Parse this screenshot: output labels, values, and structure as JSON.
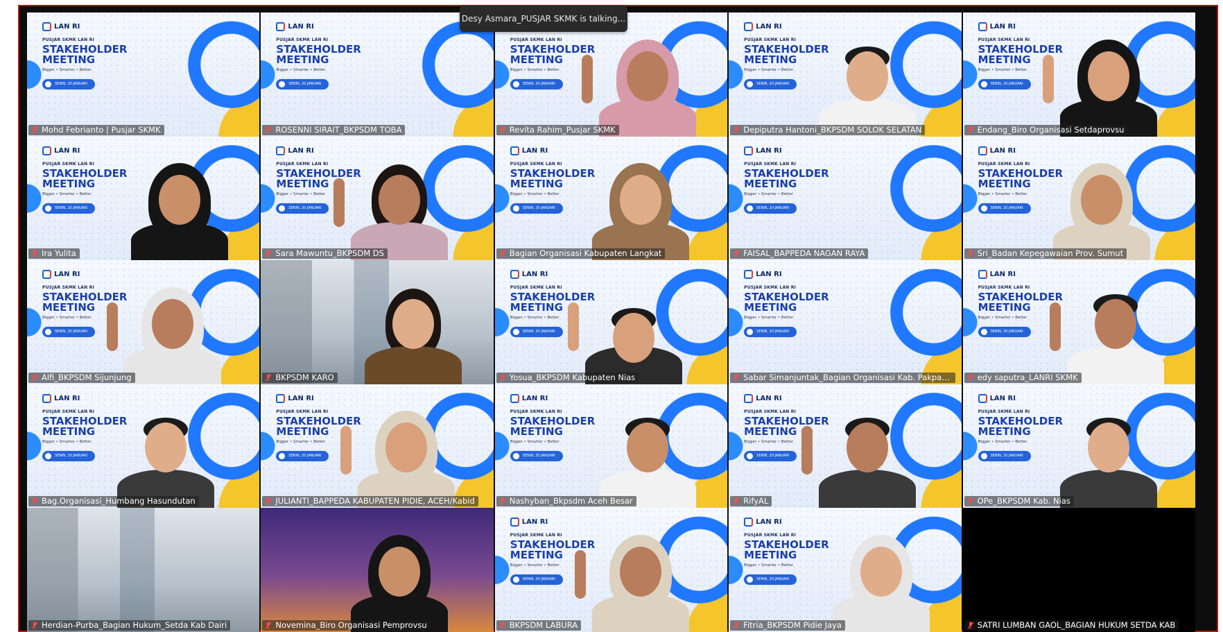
{
  "toast": "Desy Asmara_PUSJAR SKMK is talking...",
  "slide": {
    "logo": "LAN RI",
    "kicker": "PUSJAR SKMK LAN RI",
    "title": "STAKEHOLDER\nMEETING",
    "tagline": "Bigger • Smarter • Better",
    "date": "SENIN, 20 JANUARI 2025"
  },
  "colors": {
    "frame_border": "#b01818",
    "muted_mic": "#ff4a4a",
    "slide_blue": "#1a3fa8",
    "slide_yellow": "#f4c62c"
  },
  "participants": [
    {
      "name": "Mohd Febrianto | Pusjar SKMK",
      "bg": "slide",
      "person": "none"
    },
    {
      "name": "ROSENNI SIRAIT_BKPSDM TOBA",
      "bg": "slide",
      "person": "none"
    },
    {
      "name": "Revita Rahim_Pusjar SKMK",
      "bg": "slide",
      "person": "hijab-pink"
    },
    {
      "name": "Depiputra Hantoni_BKPSDM SOLOK SELATAN",
      "bg": "slide",
      "person": "man-white"
    },
    {
      "name": "Endang_Biro Organisasi Setdaprovsu",
      "bg": "slide",
      "person": "hijab-black"
    },
    {
      "name": "Ira Yulita",
      "bg": "slide",
      "person": "hijab-black"
    },
    {
      "name": "Sara Mawuntu_BKPSDM DS",
      "bg": "slide",
      "person": "woman-glasses"
    },
    {
      "name": "Bagian Organisasi Kabupaten Langkat",
      "bg": "slide",
      "person": "hijab-brown"
    },
    {
      "name": "FAISAL_BAPPEDA NAGAN RAYA",
      "bg": "slide",
      "person": "none"
    },
    {
      "name": "Sri_Badan Kepegawaian Prov. Sumut",
      "bg": "slide",
      "person": "hijab-cream"
    },
    {
      "name": "Alfi_BKPSDM Sijunjung",
      "bg": "slide",
      "person": "hijab-white"
    },
    {
      "name": "BKPSDM KARO",
      "bg": "blur",
      "person": "woman-dark"
    },
    {
      "name": "Yosua_BKPSDM Kabupaten Nias",
      "bg": "slide",
      "person": "man-low"
    },
    {
      "name": "Sabar Simanjuntak_Bagian Organisasi Kab. Pakpak Bharat",
      "bg": "slide",
      "person": "none"
    },
    {
      "name": "edy saputra_LANRI SKMK",
      "bg": "slide",
      "person": "man-white"
    },
    {
      "name": "Bag.Organisasi_Humbang Hasundutan",
      "bg": "slide",
      "person": "man-dark"
    },
    {
      "name": "JULIANTI_BAPPEDA KABUPATEN PIDIE, ACEH/Kabid",
      "bg": "slide",
      "person": "hijab-cream"
    },
    {
      "name": "Nashyban_Bkpsdm Aceh Besar",
      "bg": "slide",
      "person": "man-white"
    },
    {
      "name": "RifyAL",
      "bg": "slide",
      "person": "man-dark"
    },
    {
      "name": "OPe_BKPSDM Kab. Nias",
      "bg": "slide",
      "person": "man-dark"
    },
    {
      "name": "Herdian-Purba_Bagian Hukum_Setda Kab Dairi",
      "bg": "blur",
      "person": "none"
    },
    {
      "name": "Novemina_Biro Organisasi Pemprovsu",
      "bg": "purple",
      "person": "hijab-black"
    },
    {
      "name": "BKPSDM LABURA",
      "bg": "slide",
      "person": "hijab-cream"
    },
    {
      "name": "Fitria_BKPSDM Pidie Jaya",
      "bg": "slide",
      "person": "hijab-white"
    },
    {
      "name": "SATRI LUMBAN GAOL_BAGIAN HUKUM SETDA KAB",
      "bg": "black",
      "person": "none"
    }
  ]
}
